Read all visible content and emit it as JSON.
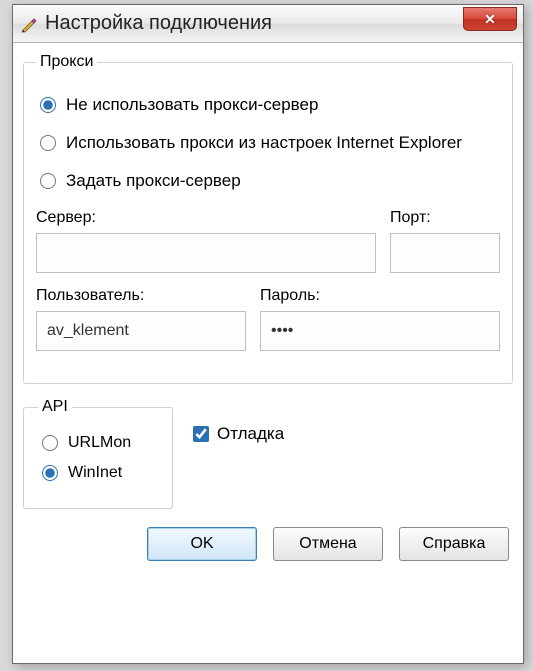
{
  "window": {
    "title": "Настройка подключения",
    "close": "✕"
  },
  "proxy": {
    "legend": "Прокси",
    "opt_none": "Не использовать прокси-сервер",
    "opt_ie": "Использовать прокси из настроек Internet Explorer",
    "opt_custom": "Задать прокси-сервер",
    "server_label": "Сервер:",
    "server_value": "",
    "port_label": "Порт:",
    "port_value": "",
    "user_label": "Пользователь:",
    "user_value": "av_klement",
    "pass_label": "Пароль:",
    "pass_value": "••••"
  },
  "api": {
    "legend": "API",
    "opt_urlmon": "URLMon",
    "opt_wininet": "WinInet"
  },
  "debug": {
    "label": "Отладка"
  },
  "buttons": {
    "ok": "OK",
    "cancel": "Отмена",
    "help": "Справка"
  }
}
